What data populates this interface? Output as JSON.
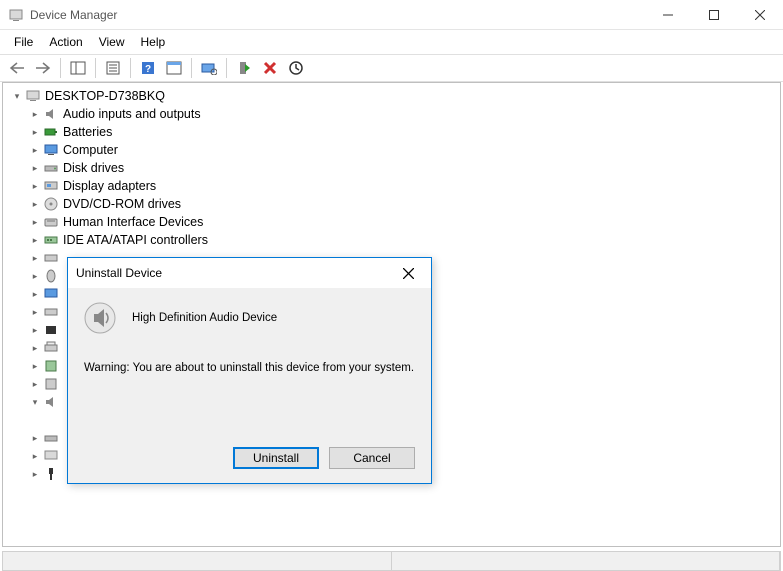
{
  "window": {
    "title": "Device Manager"
  },
  "menu": {
    "file": "File",
    "action": "Action",
    "view": "View",
    "help": "Help"
  },
  "tree": {
    "root": "DESKTOP-D738BKQ",
    "items": [
      "Audio inputs and outputs",
      "Batteries",
      "Computer",
      "Disk drives",
      "Display adapters",
      "DVD/CD-ROM drives",
      "Human Interface Devices",
      "IDE ATA/ATAPI controllers"
    ]
  },
  "dialog": {
    "title": "Uninstall Device",
    "device": "High Definition Audio Device",
    "warning": "Warning: You are about to uninstall this device from your system.",
    "uninstall": "Uninstall",
    "cancel": "Cancel"
  }
}
